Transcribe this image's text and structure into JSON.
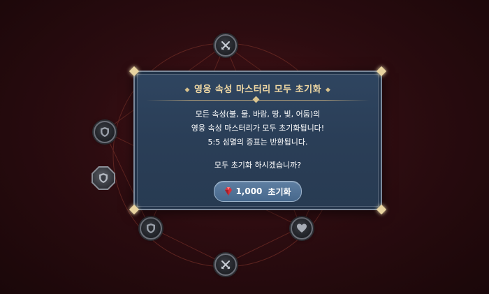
{
  "dialog": {
    "title": "영웅 속성 마스터리 모두 초기화",
    "lines": [
      "모든 속성(불, 물, 바람, 땅, 빛, 어둠)의",
      "영웅 속성 마스터리가 모두 초기화됩니다!",
      "5:5 섬멸의 증표는 반환됩니다."
    ],
    "question": "모두 초기화 하시겠습니까?",
    "confirm_button": {
      "cost": "1,000",
      "label": "초기화",
      "icon": "red-gem-icon"
    }
  },
  "nodes": [
    {
      "icon": "crossed-swords-icon"
    },
    {
      "icon": "shield-icon"
    },
    {
      "icon": "shield-icon"
    },
    {
      "icon": "shield-icon"
    },
    {
      "icon": "heart-icon"
    },
    {
      "icon": "crossed-swords-icon"
    }
  ],
  "colors": {
    "title": "#f1d9a4",
    "dialog_bg": "#2c405a",
    "button": "#5479a0",
    "background": "#2c0c10"
  }
}
